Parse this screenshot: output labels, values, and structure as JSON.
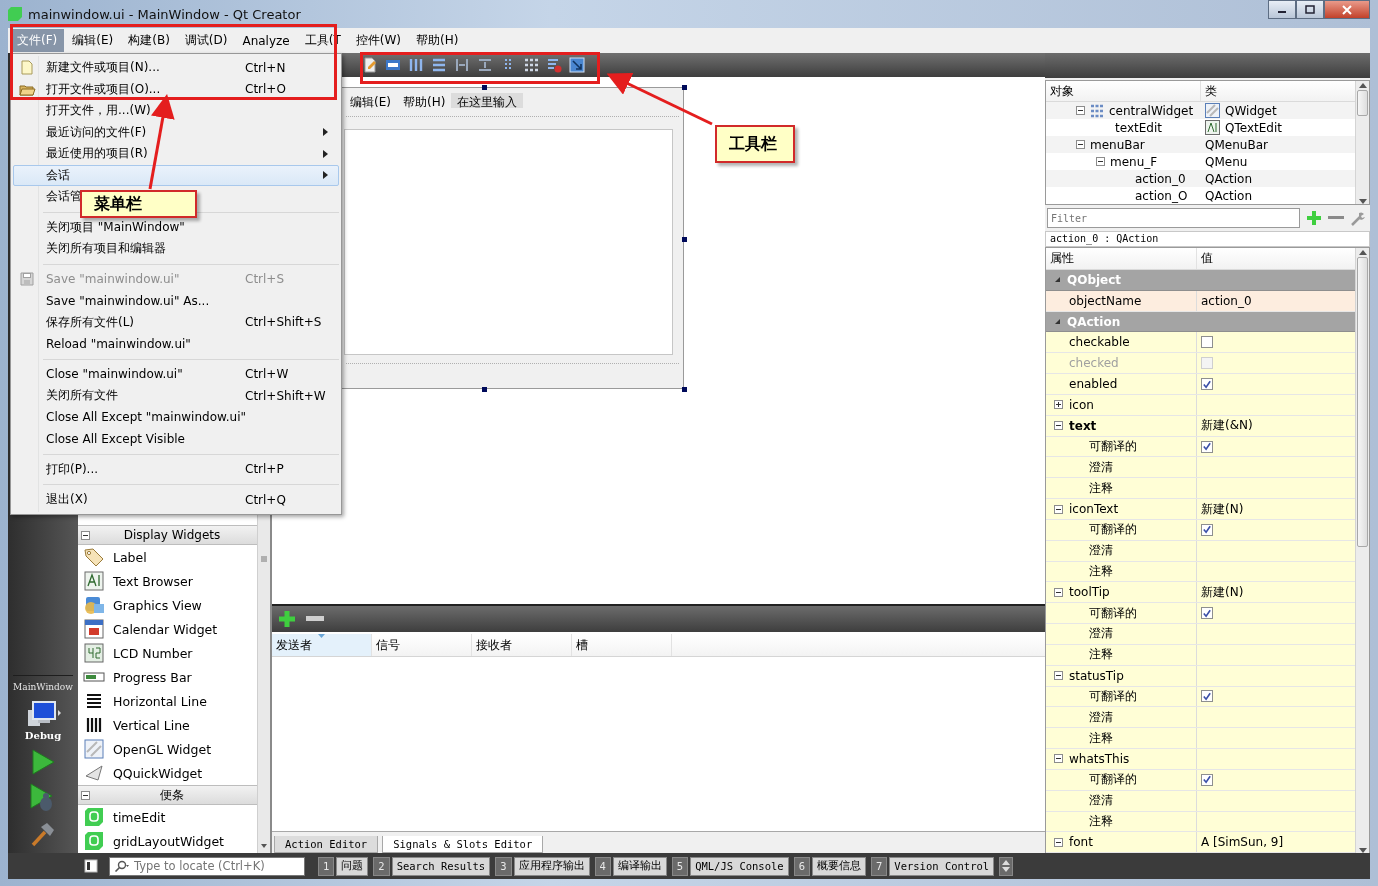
{
  "window": {
    "title": "mainwindow.ui - MainWindow - Qt Creator"
  },
  "menu_bar": [
    {
      "label": "文件(F)",
      "selected": true
    },
    {
      "label": "编辑(E)",
      "selected": false
    },
    {
      "label": "构建(B)",
      "selected": false
    },
    {
      "label": "调试(D)",
      "selected": false
    },
    {
      "label": "Analyze",
      "selected": false
    },
    {
      "label": "工具(T",
      "selected": false
    },
    {
      "label": "控件(W)",
      "selected": false
    },
    {
      "label": "帮助(H)",
      "selected": false
    }
  ],
  "file_menu": [
    {
      "kind": "item",
      "label": "新建文件或项目(N)...",
      "shortcut": "Ctrl+N",
      "submenu": false,
      "disabled": false,
      "selected": false
    },
    {
      "kind": "item",
      "label": "打开文件或项目(O)...",
      "shortcut": "Ctrl+O",
      "submenu": false,
      "disabled": false,
      "selected": false
    },
    {
      "kind": "item",
      "label": "打开文件，用...(W)",
      "submenu": false,
      "disabled": false,
      "selected": false
    },
    {
      "kind": "item",
      "label": "最近访问的文件(F)",
      "submenu": true,
      "disabled": false,
      "selected": false
    },
    {
      "kind": "item",
      "label": "最近使用的项目(R)",
      "submenu": true,
      "disabled": false,
      "selected": false
    },
    {
      "kind": "item",
      "label": "会话",
      "submenu": true,
      "disabled": false,
      "selected": true
    },
    {
      "kind": "item",
      "label": "会话管",
      "submenu": false,
      "disabled": false,
      "selected": false
    },
    {
      "kind": "separator"
    },
    {
      "kind": "item",
      "label": "关闭项目 \"MainWindow\"",
      "submenu": false,
      "disabled": false,
      "selected": false
    },
    {
      "kind": "item",
      "label": "关闭所有项目和编辑器",
      "submenu": false,
      "disabled": false,
      "selected": false
    },
    {
      "kind": "separator"
    },
    {
      "kind": "item",
      "label": "Save \"mainwindow.ui\"",
      "shortcut": "Ctrl+S",
      "submenu": false,
      "disabled": true,
      "selected": false
    },
    {
      "kind": "item",
      "label": "Save \"mainwindow.ui\" As...",
      "submenu": false,
      "disabled": false,
      "selected": false
    },
    {
      "kind": "item",
      "label": "保存所有文件(L)",
      "shortcut": "Ctrl+Shift+S",
      "submenu": false,
      "disabled": false,
      "selected": false
    },
    {
      "kind": "item",
      "label": "Reload \"mainwindow.ui\"",
      "submenu": false,
      "disabled": false,
      "selected": false
    },
    {
      "kind": "separator"
    },
    {
      "kind": "item",
      "label": "Close \"mainwindow.ui\"",
      "shortcut": "Ctrl+W",
      "submenu": false,
      "disabled": false,
      "selected": false
    },
    {
      "kind": "item",
      "label": "关闭所有文件",
      "shortcut": "Ctrl+Shift+W",
      "submenu": false,
      "disabled": false,
      "selected": false
    },
    {
      "kind": "item",
      "label": "Close All Except \"mainwindow.ui\"",
      "submenu": false,
      "disabled": false,
      "selected": false
    },
    {
      "kind": "item",
      "label": "Close All Except Visible",
      "submenu": false,
      "disabled": false,
      "selected": false
    },
    {
      "kind": "separator"
    },
    {
      "kind": "item",
      "label": "打印(P)...",
      "shortcut": "Ctrl+P",
      "submenu": false,
      "disabled": false,
      "selected": false
    },
    {
      "kind": "separator"
    },
    {
      "kind": "item",
      "label": "退出(X)",
      "shortcut": "Ctrl+Q",
      "submenu": false,
      "disabled": false,
      "selected": false
    }
  ],
  "mode_bar": {
    "project": "MainWindow",
    "build_config": "Debug"
  },
  "widget_box": {
    "categories": [
      {
        "title": "Display Widgets",
        "expanded": true,
        "items": [
          "Label",
          "Text Browser",
          "Graphics View",
          "Calendar Widget",
          "LCD Number",
          "Progress Bar",
          "Horizontal Line",
          "Vertical Line",
          "OpenGL Widget",
          "QQuickWidget"
        ]
      },
      {
        "title": "便条",
        "expanded": true,
        "items": [
          "timeEdit",
          "gridLayoutWidget"
        ]
      }
    ]
  },
  "form": {
    "menu": [
      "编辑(E)",
      "帮助(H)",
      "在这里输入"
    ]
  },
  "signal_slot_editor": {
    "columns": [
      "发送者",
      "信号",
      "接收者",
      "槽"
    ],
    "tabs": [
      {
        "label": "Action Editor",
        "selected": false
      },
      {
        "label": "Signals & Slots Editor",
        "selected": true
      }
    ]
  },
  "object_inspector": {
    "columns": [
      "对象",
      "类"
    ],
    "tree": [
      {
        "object": "centralWidget",
        "class": "QWidget",
        "expanded": true,
        "children": [
          {
            "object": "textEdit",
            "class": "QTextEdit"
          }
        ]
      },
      {
        "object": "menuBar",
        "class": "QMenuBar",
        "expanded": true,
        "children": [
          {
            "object": "menu_F",
            "class": "QMenu",
            "expanded": true,
            "children": [
              {
                "object": "action_0",
                "class": "QAction"
              },
              {
                "object": "action_O",
                "class": "QAction"
              }
            ]
          }
        ]
      }
    ]
  },
  "property_editor": {
    "filter_placeholder": "Filter",
    "current": "action_0 : QAction",
    "columns": [
      "属性",
      "值"
    ],
    "groups": [
      {
        "name": "QObject",
        "color": "#fdeddf",
        "expanded": true,
        "properties": [
          {
            "name": "objectName",
            "kind": "text",
            "value": "action_0"
          }
        ]
      },
      {
        "name": "QAction",
        "color": "#fffed6",
        "expanded": true,
        "properties": [
          {
            "name": "checkable",
            "kind": "bool",
            "checked": false,
            "disabled": false
          },
          {
            "name": "checked",
            "kind": "bool",
            "checked": false,
            "disabled": true
          },
          {
            "name": "enabled",
            "kind": "bool",
            "checked": true,
            "disabled": false
          },
          {
            "name": "icon",
            "kind": "text",
            "expanded": false
          },
          {
            "name": "text",
            "kind": "text",
            "value": "新建(&N)",
            "modified": true,
            "expanded": true,
            "children": [
              {
                "name": "可翻译的",
                "kind": "bool",
                "checked": true
              },
              {
                "name": "澄清",
                "kind": "text"
              },
              {
                "name": "注释",
                "kind": "text"
              }
            ]
          },
          {
            "name": "iconText",
            "kind": "text",
            "value": "新建(N)",
            "modified": false,
            "expanded": true,
            "children": [
              {
                "name": "可翻译的",
                "kind": "bool",
                "checked": true
              },
              {
                "name": "澄清",
                "kind": "text"
              },
              {
                "name": "注释",
                "kind": "text"
              }
            ]
          },
          {
            "name": "toolTip",
            "kind": "text",
            "value": "新建(N)",
            "modified": false,
            "expanded": true,
            "children": [
              {
                "name": "可翻译的",
                "kind": "bool",
                "checked": true
              },
              {
                "name": "澄清",
                "kind": "text"
              },
              {
                "name": "注释",
                "kind": "text"
              }
            ]
          },
          {
            "name": "statusTip",
            "kind": "text",
            "modified": false,
            "expanded": true,
            "children": [
              {
                "name": "可翻译的",
                "kind": "bool",
                "checked": true
              },
              {
                "name": "澄清",
                "kind": "text"
              },
              {
                "name": "注释",
                "kind": "text"
              }
            ]
          },
          {
            "name": "whatsThis",
            "kind": "text",
            "modified": false,
            "expanded": true,
            "children": [
              {
                "name": "可翻译的",
                "kind": "bool",
                "checked": true
              },
              {
                "name": "澄清",
                "kind": "text"
              },
              {
                "name": "注释",
                "kind": "text"
              }
            ]
          },
          {
            "name": "font",
            "kind": "text",
            "value": "A  [SimSun, 9]",
            "modified": false,
            "expanded": true
          }
        ]
      }
    ]
  },
  "status_bar": {
    "locate_placeholder": "Type to locate (Ctrl+K)",
    "panes": [
      {
        "number": "1",
        "label": "问题"
      },
      {
        "number": "2",
        "label": "Search Results"
      },
      {
        "number": "3",
        "label": "应用程序输出"
      },
      {
        "number": "4",
        "label": "编译输出"
      },
      {
        "number": "5",
        "label": "QML/JS Console"
      },
      {
        "number": "6",
        "label": "概要信息"
      },
      {
        "number": "7",
        "label": "Version Control"
      }
    ]
  },
  "annotations": [
    {
      "label": "菜单栏"
    },
    {
      "label": "工具栏"
    }
  ]
}
